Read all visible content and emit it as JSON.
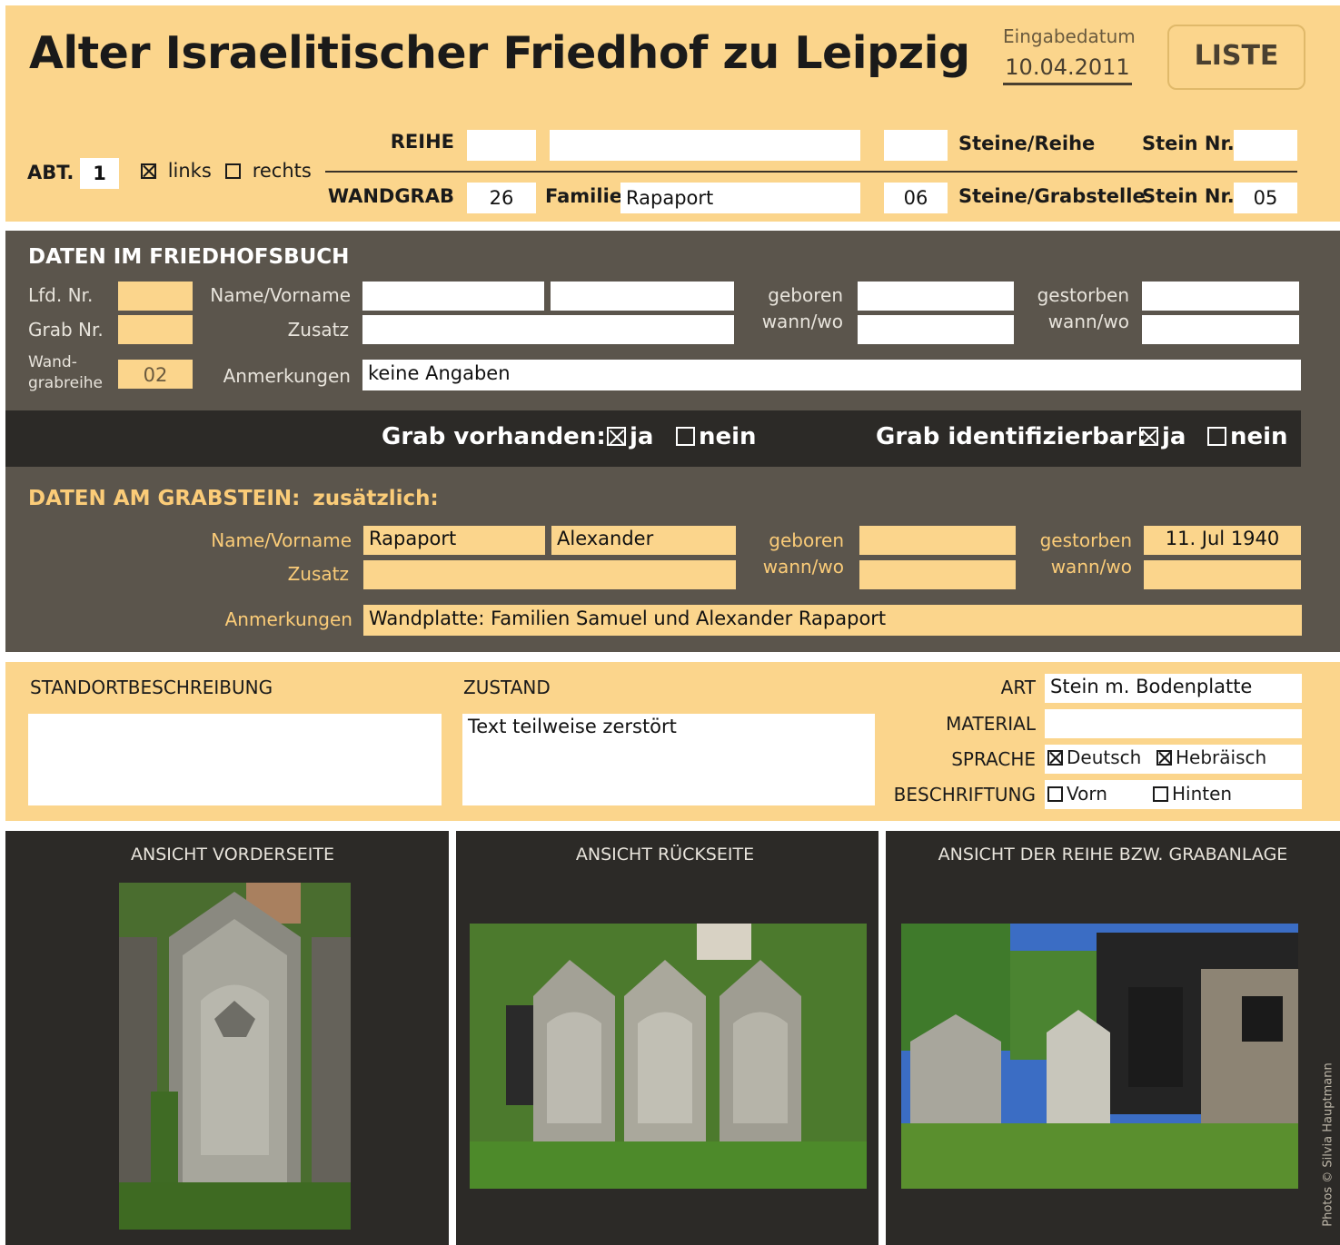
{
  "colors": {
    "cream": "#fbd58c",
    "taupe": "#5b554c",
    "dark": "#2c2a27",
    "white": "#ffffff",
    "title": "#1a1a1a",
    "label_taupe": "#e8e4dc",
    "label_orange": "#fbcc78"
  },
  "header": {
    "title": "Alter Israelitischer Friedhof zu Leipzig",
    "date_label": "Eingabedatum",
    "date_value": "10.04.2011",
    "liste_button": "LISTE",
    "abt_label": "ABT.",
    "abt_value": "1",
    "links_label": "links",
    "links_checked": true,
    "rechts_label": "rechts",
    "rechts_checked": false,
    "reihe_label": "REIHE",
    "reihe_value": "",
    "reihe_name": "",
    "reihe_count": "",
    "steine_reihe_label": "Steine/Reihe",
    "stein_nr_label": "Stein Nr.",
    "stein_nr_reihe_value": "",
    "wandgrab_label": "WANDGRAB",
    "wandgrab_value": "26",
    "familie_label": "Familie",
    "familie_value": "Rapaport",
    "wandgrab_count": "06",
    "steine_grabstelle_label": "Steine/Grabstelle",
    "stein_nr_grab_value": "05"
  },
  "friedhofsbuch": {
    "heading": "DATEN IM FRIEDHOFSBUCH",
    "lfd_label": "Lfd. Nr.",
    "lfd_value": "",
    "grab_label": "Grab Nr.",
    "grab_value": "",
    "wandgrab_label_1": "Wand-",
    "wandgrab_label_2": "grabreihe",
    "wandgrab_value": "02",
    "name_label": "Name/Vorname",
    "name_value": "",
    "vorname_value": "",
    "zusatz_label": "Zusatz",
    "zusatz_value": "",
    "geboren_label": "geboren",
    "geboren_sub": "wann/wo",
    "geboren_wann": "",
    "geboren_wo": "",
    "gestorben_label": "gestorben",
    "gestorben_sub": "wann/wo",
    "gestorben_wann": "",
    "gestorben_wo": "",
    "anmerkungen_label": "Anmerkungen",
    "anmerkungen_value": "keine Angaben"
  },
  "status_bar": {
    "vorhanden_label": "Grab vorhanden:",
    "vorhanden_ja": "ja",
    "vorhanden_ja_checked": true,
    "vorhanden_nein": "nein",
    "vorhanden_nein_checked": false,
    "identifizierbar_label": "Grab identifizierbar:",
    "identifizierbar_ja": "ja",
    "identifizierbar_ja_checked": true,
    "identifizierbar_nein": "nein",
    "identifizierbar_nein_checked": false
  },
  "grabstein": {
    "heading": "DATEN AM GRABSTEIN:",
    "heading_extra": "zusätzlich:",
    "name_label": "Name/Vorname",
    "name_value": "Rapaport",
    "vorname_value": "Alexander",
    "zusatz_label": "Zusatz",
    "zusatz_value": "",
    "geboren_label": "geboren",
    "geboren_sub": "wann/wo",
    "geboren_wann": "",
    "geboren_wo": "",
    "gestorben_label": "gestorben",
    "gestorben_sub": "wann/wo",
    "gestorben_wann": "11. Jul 1940",
    "gestorben_wo": "",
    "anmerkungen_label": "Anmerkungen",
    "anmerkungen_value": "Wandplatte: Familien Samuel und Alexander Rapaport"
  },
  "description": {
    "standort_label": "STANDORTBESCHREIBUNG",
    "standort_value": "",
    "zustand_label": "ZUSTAND",
    "zustand_value": "Text teilweise zerstört",
    "art_label": "ART",
    "art_value": "Stein m. Bodenplatte",
    "material_label": "MATERIAL",
    "material_value": "",
    "sprache_label": "SPRACHE",
    "sprache_deutsch": "Deutsch",
    "sprache_deutsch_checked": true,
    "sprache_hebraeisch": "Hebräisch",
    "sprache_hebraeisch_checked": true,
    "beschriftung_label": "BESCHRIFTUNG",
    "beschriftung_vorn": "Vorn",
    "beschriftung_vorn_checked": false,
    "beschriftung_hinten": "Hinten",
    "beschriftung_hinten_checked": false
  },
  "photos": {
    "front_label": "ANSICHT VORDERSEITE",
    "back_label": "ANSICHT RÜCKSEITE",
    "row_label": "ANSICHT DER REIHE BZW. GRABANLAGE",
    "credit": "Photos © Silvia Hauptmann"
  }
}
